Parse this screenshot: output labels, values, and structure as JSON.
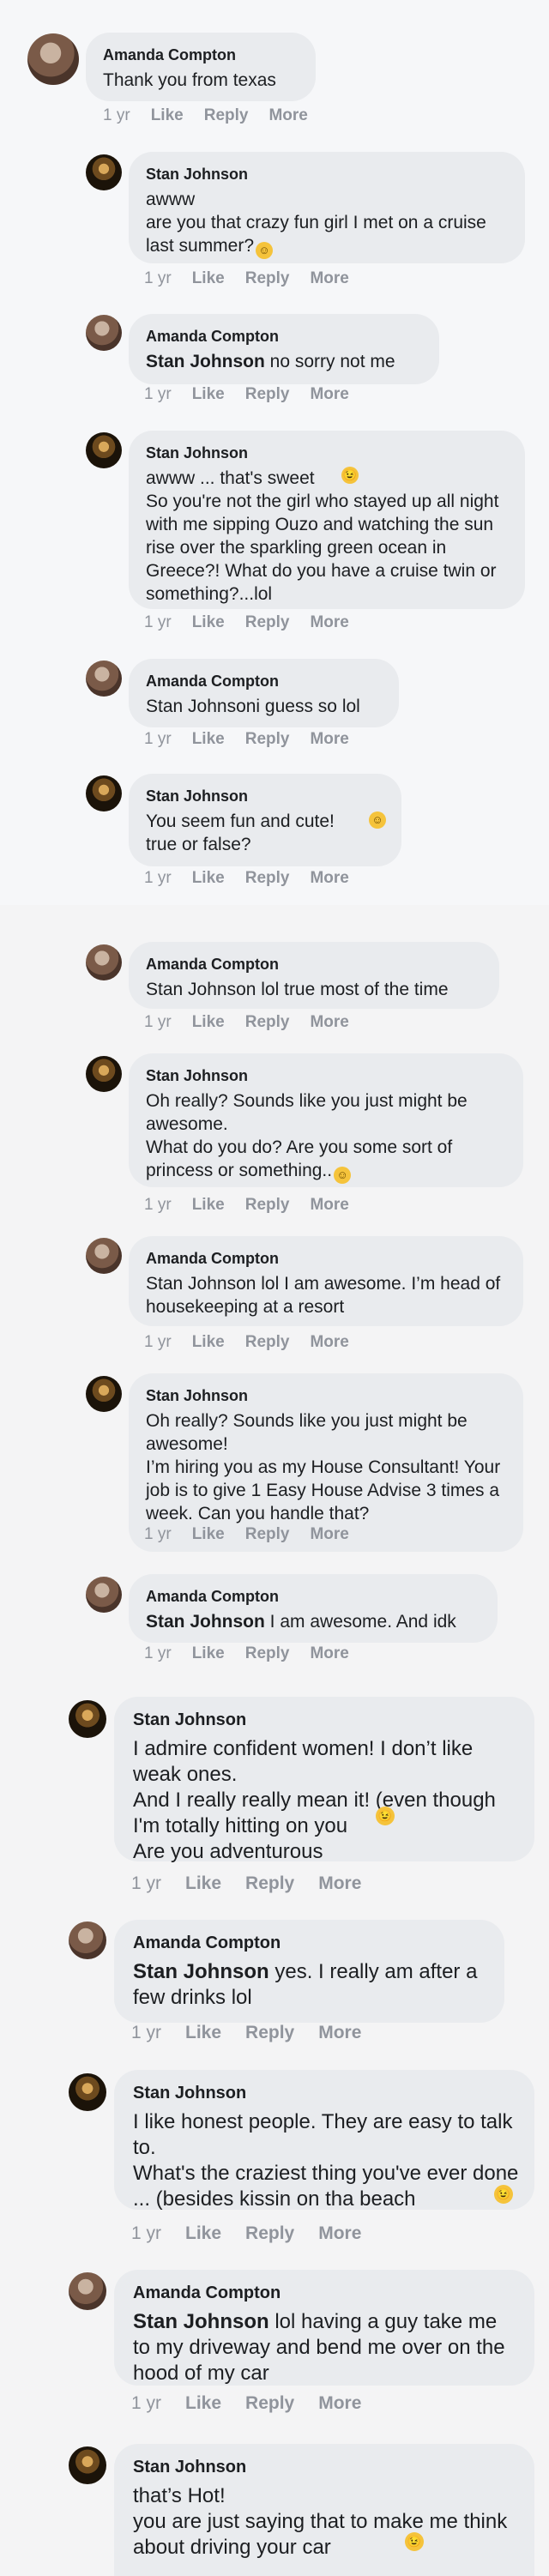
{
  "actions": {
    "age": "1 yr",
    "like": "Like",
    "reply": "Reply",
    "more": "More"
  },
  "comments": [
    {
      "author": "Amanda Compton",
      "text": "Thank you from texas"
    },
    {
      "author": "Stan Johnson",
      "text": "awww\nare you that crazy fun girl I met on a cruise last summer?"
    },
    {
      "author": "Amanda Compton",
      "tag": "Stan Johnson",
      "text": " no sorry not me"
    },
    {
      "author": "Stan Johnson",
      "text": "awww ... that's sweet \nSo you're not the girl who stayed up all night with me sipping Ouzo and watching the sun rise over the sparkling green ocean in Greece?! What do you have a cruise twin or something?...lol"
    },
    {
      "author": "Amanda Compton",
      "text": "Stan Johnsoni guess so lol"
    },
    {
      "author": "Stan Johnson",
      "text": "You seem fun and cute! \ntrue or false?"
    },
    {
      "author": "Amanda Compton",
      "text": "Stan Johnson lol true most of the time"
    },
    {
      "author": "Stan Johnson",
      "text": "Oh really? Sounds like you just might be awesome.\nWhat do you do? Are you some sort of princess or something.."
    },
    {
      "author": "Amanda Compton",
      "text": "Stan Johnson lol I am awesome. I’m head of housekeeping at a resort"
    },
    {
      "author": "Stan Johnson",
      "text": "Oh really? Sounds like you just might be awesome!\nI’m hiring you as my House Consultant! Your job is to give 1 Easy House Advise 3 times a week. Can you handle that?"
    },
    {
      "author": "Amanda Compton",
      "tag": "Stan Johnson",
      "text": " I am awesome. And idk"
    },
    {
      "author": "Stan Johnson",
      "text": "I admire confident women! I don’t like weak ones.\nAnd I really really mean it! (even though I'm totally hitting on you \nAre you adventurous"
    },
    {
      "author": "Amanda Compton",
      "tag": "Stan Johnson",
      "text": " yes. I really am after a few drinks lol"
    },
    {
      "author": "Stan Johnson",
      "text": "I like honest people. They are easy to talk to.\nWhat's the craziest thing you've ever done ... (besides kissin on tha beach "
    },
    {
      "author": "Amanda Compton",
      "tag": "Stan Johnson",
      "text": " lol having a guy take me to my driveway and bend me over on the hood of my car"
    },
    {
      "author": "Stan Johnson",
      "text": "that’s Hot!\nyou are just saying that to make me think about driving your car "
    }
  ],
  "emoji": {
    "smile": "☺",
    "wink": "😉"
  }
}
